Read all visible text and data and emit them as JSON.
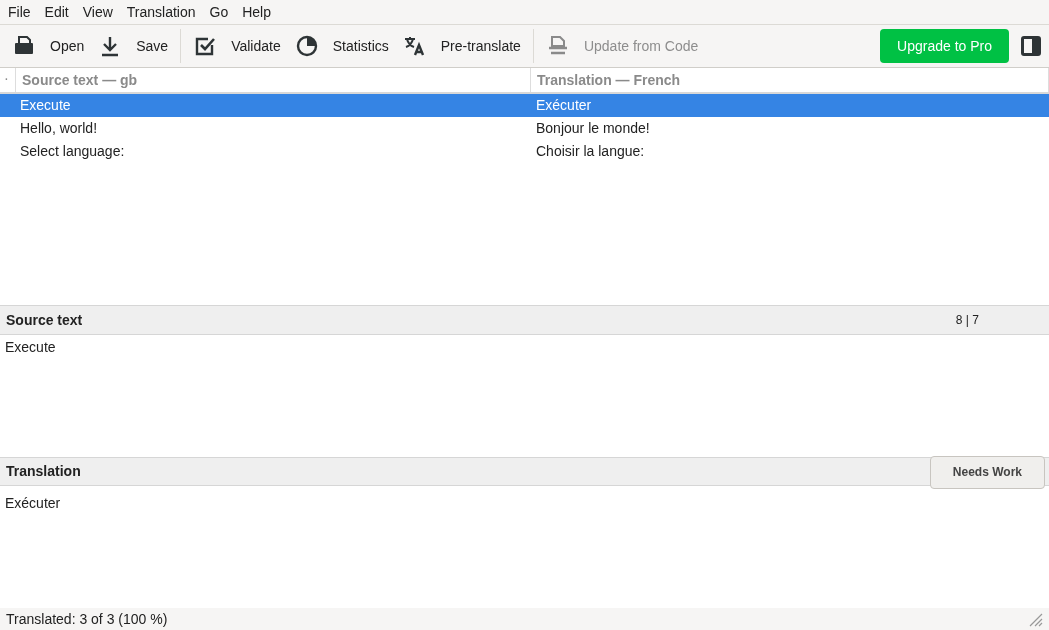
{
  "menu": [
    "File",
    "Edit",
    "View",
    "Translation",
    "Go",
    "Help"
  ],
  "toolbar": [
    {
      "kind": "button",
      "label": "Open",
      "disabled": false
    },
    {
      "kind": "button",
      "label": "Save",
      "disabled": false
    },
    {
      "kind": "separator"
    },
    {
      "kind": "button",
      "label": "Validate",
      "disabled": false
    },
    {
      "kind": "button",
      "label": "Statistics",
      "disabled": false
    },
    {
      "kind": "button",
      "label": "Pre-translate",
      "disabled": false
    },
    {
      "kind": "separator"
    },
    {
      "kind": "button",
      "label": "Update from Code",
      "disabled": true
    }
  ],
  "upgrade_button": "Upgrade to Pro",
  "table": {
    "marker": "·",
    "columns": [
      "Source text — gb",
      "Translation — French"
    ],
    "rows": [
      {
        "cells": [
          "Execute",
          "Exécuter"
        ],
        "selected": true
      },
      {
        "cells": [
          "Hello, world!",
          "Bonjour le monde!"
        ],
        "selected": false
      },
      {
        "cells": [
          "Select language:",
          "Choisir la langue:"
        ],
        "selected": false
      }
    ]
  },
  "source_panel": {
    "title": "Source text",
    "counter": "8 | 7",
    "text": "Execute"
  },
  "translation_panel": {
    "title": "Translation",
    "button": "Needs Work",
    "text": "Exécuter"
  },
  "status_bar": "Translated: 3 of 3 (100 %)"
}
